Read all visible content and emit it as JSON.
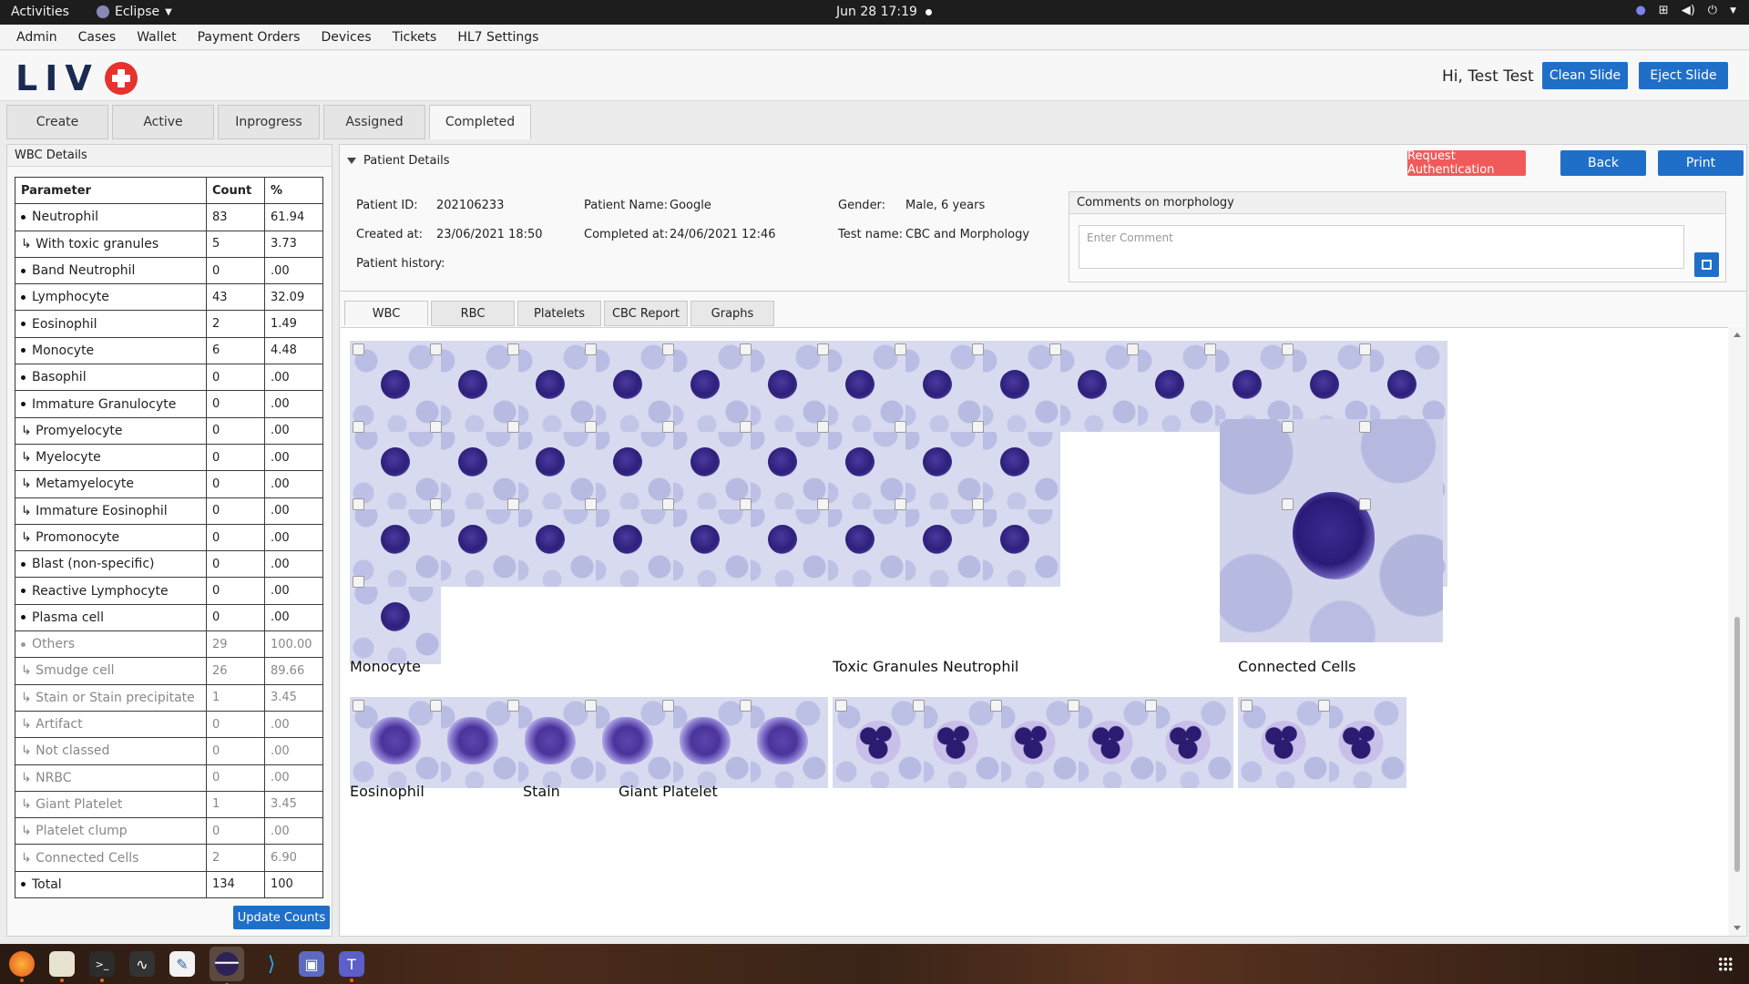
{
  "system": {
    "activities": "Activities",
    "app_name": "Eclipse",
    "clock": "Jun 28  17:19"
  },
  "menu": [
    "Admin",
    "Cases",
    "Wallet",
    "Payment Orders",
    "Devices",
    "Tickets",
    "HL7 Settings"
  ],
  "header": {
    "logo": "LIV",
    "greeting": "Hi, Test Test",
    "clean_slide": "Clean Slide",
    "eject_slide": "Eject Slide"
  },
  "main_tabs": [
    "Create",
    "Active",
    "Inprogress",
    "Assigned",
    "Completed"
  ],
  "active_main_tab": "Completed",
  "wbc_panel": {
    "title": "WBC Details",
    "headers": [
      "Parameter",
      "Count",
      "%"
    ],
    "rows": [
      {
        "label": "Neutrophil",
        "count": "83",
        "pct": "61.94"
      },
      {
        "label": "↳ With toxic granules",
        "count": "5",
        "pct": "3.73"
      },
      {
        "label": "Band Neutrophil",
        "count": "0",
        "pct": ".00"
      },
      {
        "label": "Lymphocyte",
        "count": "43",
        "pct": "32.09"
      },
      {
        "label": "Eosinophil",
        "count": "2",
        "pct": "1.49"
      },
      {
        "label": "Monocyte",
        "count": "6",
        "pct": "4.48"
      },
      {
        "label": "Basophil",
        "count": "0",
        "pct": ".00"
      },
      {
        "label": "Immature Granulocyte",
        "count": "0",
        "pct": ".00"
      },
      {
        "label": "↳ Promyelocyte",
        "count": "0",
        "pct": ".00"
      },
      {
        "label": "↳ Myelocyte",
        "count": "0",
        "pct": ".00"
      },
      {
        "label": "↳ Metamyelocyte",
        "count": "0",
        "pct": ".00"
      },
      {
        "label": "↳ Immature Eosinophil",
        "count": "0",
        "pct": ".00"
      },
      {
        "label": "↳ Promonocyte",
        "count": "0",
        "pct": ".00"
      },
      {
        "label": "Blast (non-specific)",
        "count": "0",
        "pct": ".00"
      },
      {
        "label": "Reactive Lymphocyte",
        "count": "0",
        "pct": ".00"
      },
      {
        "label": "Plasma cell",
        "count": "0",
        "pct": ".00"
      },
      {
        "label": "Others",
        "count": "29",
        "pct": "100.00"
      },
      {
        "label": "↳ Smudge cell",
        "count": "26",
        "pct": "89.66"
      },
      {
        "label": "↳ Stain or Stain precipitate",
        "count": "1",
        "pct": "3.45"
      },
      {
        "label": "↳ Artifact",
        "count": "0",
        "pct": ".00"
      },
      {
        "label": "↳ Not classed",
        "count": "0",
        "pct": ".00"
      },
      {
        "label": "↳ NRBC",
        "count": "0",
        "pct": ".00"
      },
      {
        "label": "↳ Giant Platelet",
        "count": "1",
        "pct": "3.45"
      },
      {
        "label": "↳ Platelet clump",
        "count": "0",
        "pct": ".00"
      },
      {
        "label": "↳ Connected Cells",
        "count": "2",
        "pct": "6.90"
      },
      {
        "label": "Total",
        "count": "134",
        "pct": "100"
      }
    ],
    "update_button": "Update Counts"
  },
  "patient": {
    "section_title": "Patient Details",
    "request_auth": "Request Authentication",
    "back": "Back",
    "print": "Print",
    "id_label": "Patient ID:",
    "id_value": "202106233",
    "name_label": "Patient Name:",
    "name_value": "Google",
    "gender_label": "Gender:",
    "gender_value": "Male, 6 years",
    "created_label": "Created at:",
    "created_value": "23/06/2021 18:50",
    "completed_label": "Completed at:",
    "completed_value": "24/06/2021 12:46",
    "test_label": "Test name:",
    "test_value": "CBC and Morphology",
    "history_label": "Patient history:"
  },
  "comments": {
    "title": "Comments on morphology",
    "placeholder": "Enter Comment"
  },
  "sub_tabs": [
    "WBC",
    "RBC",
    "Platelets",
    "CBC Report",
    "Graphs"
  ],
  "active_sub_tab": "WBC",
  "sections": {
    "monocyte": "Monocyte",
    "toxic": "Toxic Granules Neutrophil",
    "connected": "Connected Cells",
    "eosinophil": "Eosinophil",
    "stain": "Stain",
    "giant_platelet": "Giant Platelet"
  },
  "colors": {
    "primary_blue": "#1f6fc9",
    "auth_red": "#f15a5a",
    "logo_navy": "#1a2a52",
    "logo_red": "#e5322d"
  }
}
